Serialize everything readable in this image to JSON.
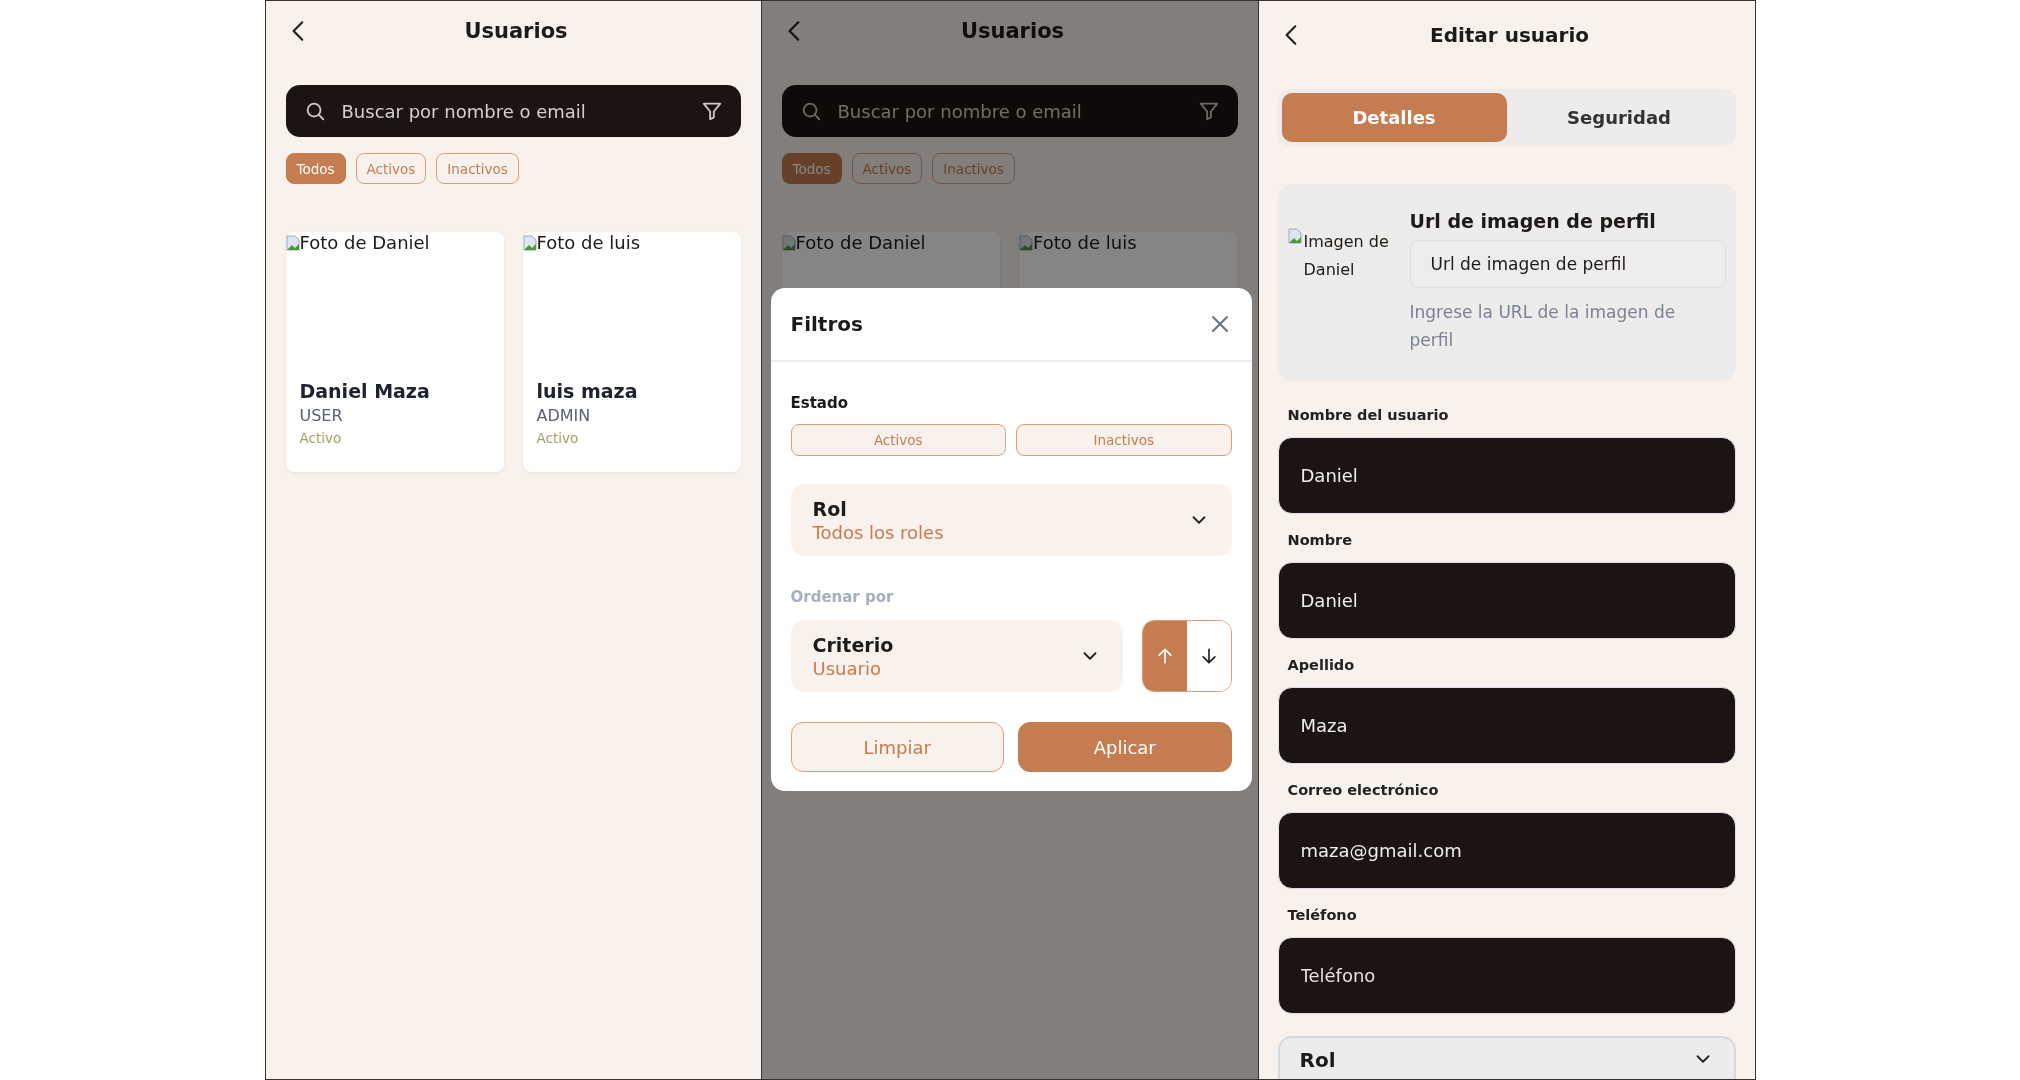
{
  "user_list": {
    "title": "Usuarios",
    "search": {
      "placeholder": "Buscar por nombre o email"
    },
    "chips": [
      {
        "label": "Todos",
        "selected": true
      },
      {
        "label": "Activos",
        "selected": false
      },
      {
        "label": "Inactivos",
        "selected": false
      }
    ],
    "users": [
      {
        "photo_alt": "Foto de Daniel",
        "name": "Daniel Maza",
        "role": "USER",
        "status": "Activo"
      },
      {
        "photo_alt": "Foto de luis",
        "name": "luis maza",
        "role": "ADMIN",
        "status": "Activo"
      }
    ]
  },
  "filter_screen": {
    "background": {
      "title": "Usuarios",
      "search": {
        "placeholder": "Buscar por nombre o email"
      },
      "chips": [
        {
          "label": "Todos",
          "selected": true
        },
        {
          "label": "Activos",
          "selected": false
        },
        {
          "label": "Inactivos",
          "selected": false
        }
      ],
      "users": [
        {
          "photo_alt": "Foto de Daniel"
        },
        {
          "photo_alt": "Foto de luis"
        }
      ]
    },
    "sheet": {
      "title": "Filtros",
      "status_label": "Estado",
      "status_options": [
        {
          "label": "Activos",
          "selected": false
        },
        {
          "label": "Inactivos",
          "selected": false
        }
      ],
      "role_select": {
        "label": "Rol",
        "value": "Todos los roles"
      },
      "sort_label": "Ordenar por",
      "sort_select": {
        "label": "Criterio",
        "value": "Usuario"
      },
      "sort_direction": [
        {
          "kind": "up",
          "selected": true
        },
        {
          "kind": "down",
          "selected": false
        }
      ],
      "buttons": [
        {
          "kind": "secondary",
          "label": "Limpiar"
        },
        {
          "kind": "primary",
          "label": "Aplicar"
        }
      ]
    }
  },
  "edit_user": {
    "title": "Editar usuario",
    "tabs": [
      {
        "label": "Detalles",
        "selected": true
      },
      {
        "label": "Seguridad",
        "selected": false
      }
    ],
    "image_card": {
      "image_alt": "Imagen de Daniel",
      "title": "Url de imagen de perfil",
      "value": "Url de imagen de perfil",
      "hint": "Ingrese la URL de la imagen de perfil"
    },
    "fields": [
      {
        "label": "Nombre del usuario",
        "value": "Daniel"
      },
      {
        "label": "Nombre",
        "value": "Daniel"
      },
      {
        "label": "Apellido",
        "value": "Maza"
      },
      {
        "label": "Correo electrónico",
        "value": "maza@gmail.com"
      },
      {
        "label": "Teléfono",
        "placeholder": "Teléfono"
      }
    ],
    "role_select": {
      "label": "Rol"
    }
  }
}
